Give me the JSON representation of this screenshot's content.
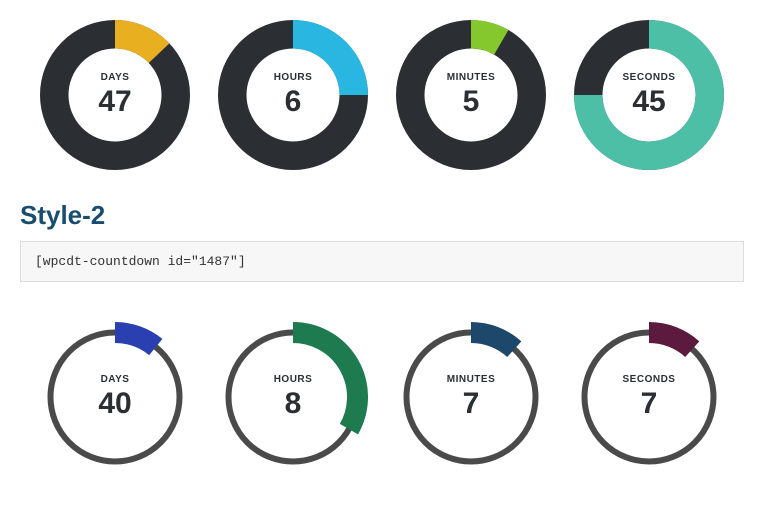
{
  "style1": {
    "ring_bg": "#2b2f33",
    "gauges": [
      {
        "label": "DAYS",
        "value": "47",
        "fraction": 0.129,
        "color": "#e8b020"
      },
      {
        "label": "HOURS",
        "value": "6",
        "fraction": 0.25,
        "color": "#29b6e0"
      },
      {
        "label": "MINUTES",
        "value": "5",
        "fraction": 0.083,
        "color": "#85c82d"
      },
      {
        "label": "SECONDS",
        "value": "45",
        "fraction": 0.75,
        "color": "#4cbfa6"
      }
    ]
  },
  "heading": "Style-2",
  "shortcode": "[wpcdt-countdown id=\"1487\"]",
  "style2": {
    "ring_bg": "#4a4a4a",
    "gauges": [
      {
        "label": "DAYS",
        "value": "40",
        "fraction": 0.109,
        "color": "#2a3fb0"
      },
      {
        "label": "HOURS",
        "value": "8",
        "fraction": 0.333,
        "color": "#1e7a4f"
      },
      {
        "label": "MINUTES",
        "value": "7",
        "fraction": 0.117,
        "color": "#1d476b"
      },
      {
        "label": "SECONDS",
        "value": "7",
        "fraction": 0.117,
        "color": "#5b1a3e"
      }
    ]
  }
}
